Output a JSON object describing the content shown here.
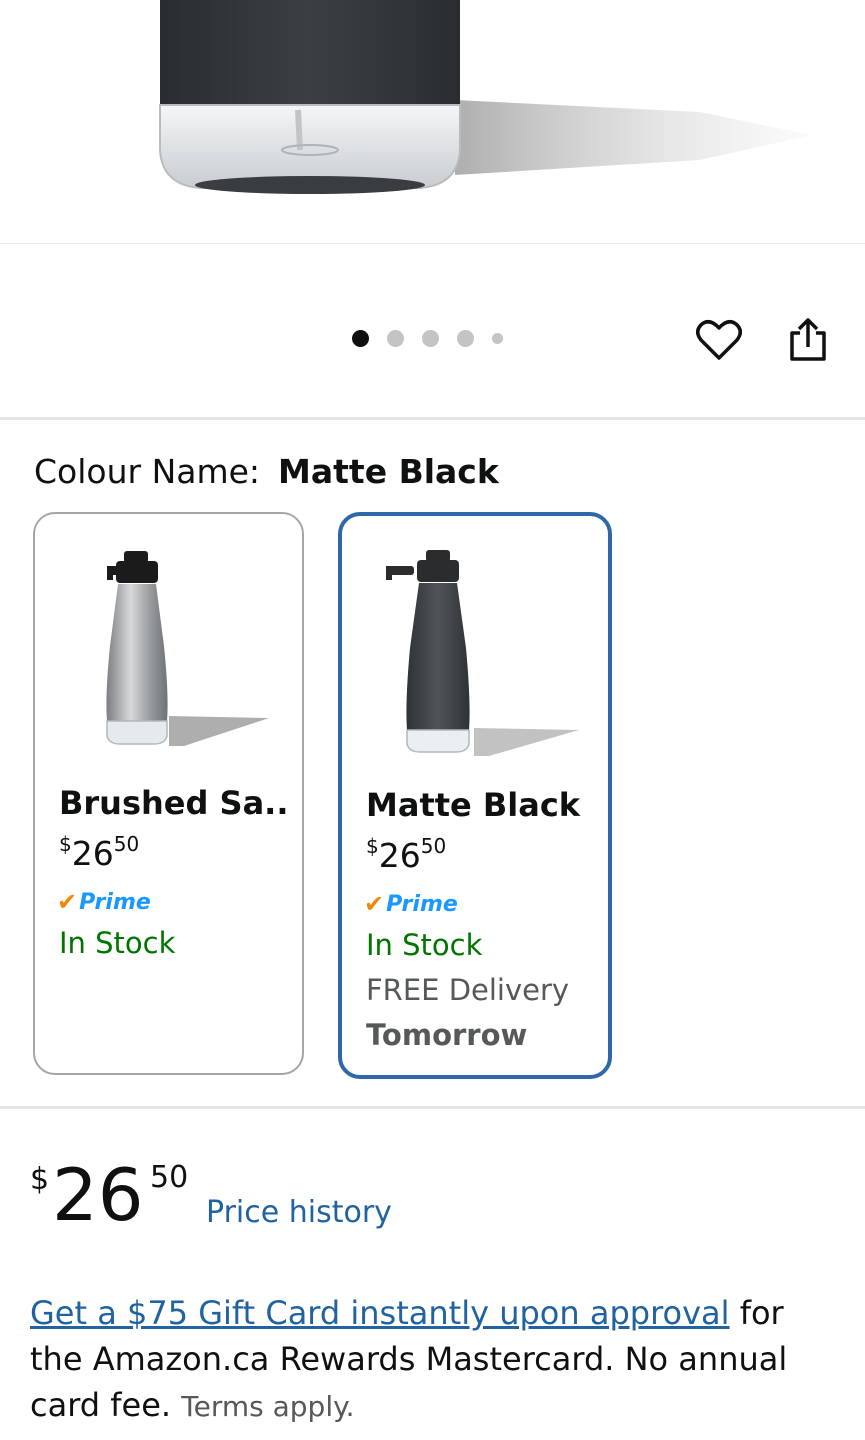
{
  "product": {
    "image_alt": "soap-dispenser"
  },
  "carousel": {
    "count": 5,
    "active": 0
  },
  "actions": {
    "wishlist_icon": "heart-icon",
    "share_icon": "share-icon"
  },
  "colour": {
    "label": "Colour Name:",
    "selected": "Matte Black"
  },
  "swatches": [
    {
      "name": "Brushed Sa...",
      "currency": "$",
      "whole": "26",
      "cents": "50",
      "prime": "Prime",
      "stock": "In Stock",
      "selected": false
    },
    {
      "name": "Matte Black",
      "currency": "$",
      "whole": "26",
      "cents": "50",
      "prime": "Prime",
      "stock": "In Stock",
      "delivery": "FREE Delivery",
      "delivery_day": "Tomorrow",
      "selected": true
    }
  ],
  "price": {
    "currency": "$",
    "whole": "26",
    "cents": "50",
    "history_link": "Price history"
  },
  "promo": {
    "link_text": "Get a $75 Gift Card instantly upon approval",
    "text": " for the Amazon.ca Rewards Mastercard. No annual card fee.",
    "terms": "Terms apply."
  },
  "colors": {
    "selected_border": "#2e68a8",
    "link": "#2162a1",
    "in_stock": "#007600",
    "prime_blue": "#1a98ff",
    "prime_check": "#f08804"
  }
}
